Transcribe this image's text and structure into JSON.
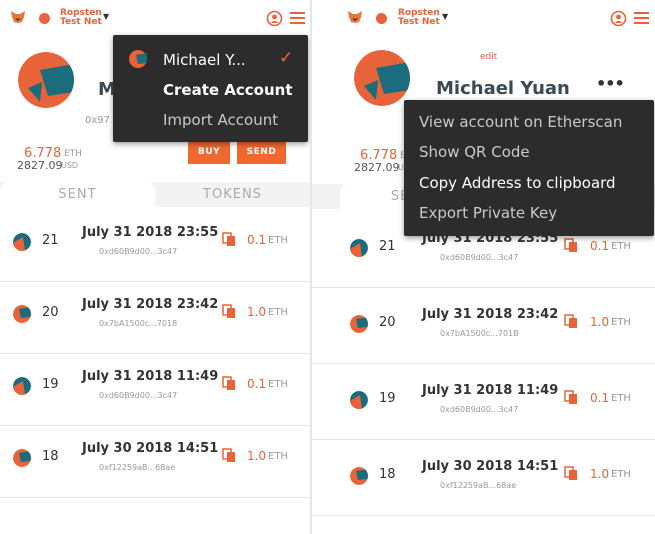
{
  "network": {
    "name_line1": "Ropsten",
    "name_line2": "Test Net",
    "color": "#e8633a"
  },
  "account": {
    "name": "Michael Yuan",
    "address_short_left": "0x97",
    "edit_label": "edit"
  },
  "balance": {
    "eth_value": "6.778",
    "eth_unit": "ETH",
    "usd_value": "2827.09",
    "usd_unit": "USD"
  },
  "buttons": {
    "buy": "BUY",
    "send": "SEND"
  },
  "tabs": {
    "sent": "SENT",
    "tokens": "TOKENS"
  },
  "transactions_left": [
    {
      "nonce": "21",
      "date": "July 31 2018 23:55",
      "hash": "0xd60B9d00...3c47",
      "amount": "0.1",
      "unit": "ETH"
    },
    {
      "nonce": "20",
      "date": "July 31 2018 23:42",
      "hash": "0x7bA1500c...7018",
      "amount": "1.0",
      "unit": "ETH"
    },
    {
      "nonce": "19",
      "date": "July 31 2018 11:49",
      "hash": "0xd60B9d00...3c47",
      "amount": "0.1",
      "unit": "ETH"
    },
    {
      "nonce": "18",
      "date": "July 30 2018 14:51",
      "hash": "0xf12259aB...68ae",
      "amount": "1.0",
      "unit": "ETH"
    }
  ],
  "transactions_right": [
    {
      "nonce": "21",
      "date": "July 31 2018 23:55",
      "hash": "0xd60B9d00...3c47",
      "amount": "0.1",
      "unit": "ETH"
    },
    {
      "nonce": "20",
      "date": "July 31 2018 23:42",
      "hash": "0x7bA1500c...701B",
      "amount": "1.0",
      "unit": "ETH"
    },
    {
      "nonce": "19",
      "date": "July 31 2018 11:49",
      "hash": "0xd60B9d00...3c47",
      "amount": "0.1",
      "unit": "ETH"
    },
    {
      "nonce": "18",
      "date": "July 30 2018 14:51",
      "hash": "0xf12259aB...68ae",
      "amount": "1.0",
      "unit": "ETH"
    }
  ],
  "account_menu": {
    "selected_account": "Michael Y...",
    "check": "✓",
    "create_account": "Create Account",
    "import_account": "Import Account"
  },
  "options_menu": {
    "view_etherscan": "View account on Etherscan",
    "show_qr": "Show QR Code",
    "copy_address": "Copy Address to clipboard",
    "export_key": "Export Private Key"
  },
  "colors": {
    "accent": "#f0682e",
    "avatar_teal": "#1b6c7c",
    "avatar_orange": "#e8633a",
    "menu_bg": "#2c2c2c"
  },
  "icons": [
    "fox-logo-icon",
    "account-switch-icon",
    "hamburger-menu-icon",
    "copy-icon",
    "identicon-avatar",
    "more-dots-icon",
    "checkmark-icon"
  ]
}
